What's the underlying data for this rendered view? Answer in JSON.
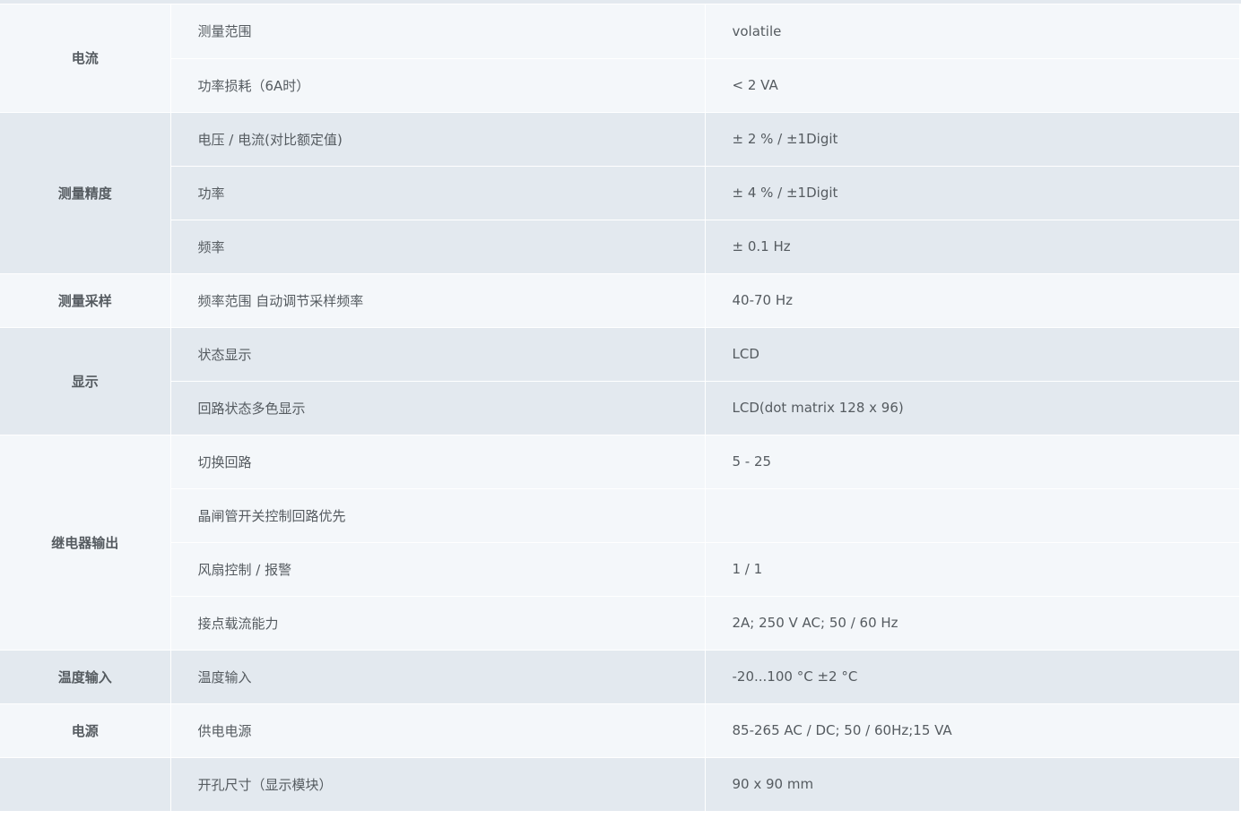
{
  "sections": [
    {
      "category": "电流",
      "rows": [
        {
          "item": "测量范围",
          "value": "volatile"
        },
        {
          "item": "功率损耗（6A时）",
          "value": "< 2 VA"
        }
      ]
    },
    {
      "category": "测量精度",
      "rows": [
        {
          "item": "电压 / 电流(对比额定值)",
          "value": "± 2 % / ±1Digit"
        },
        {
          "item": "功率",
          "value": "± 4 % / ±1Digit"
        },
        {
          "item": "频率",
          "value": "± 0.1 Hz"
        }
      ]
    },
    {
      "category": "测量采样",
      "rows": [
        {
          "item": "频率范围 自动调节采样频率",
          "value": "40-70 Hz"
        }
      ]
    },
    {
      "category": "显示",
      "rows": [
        {
          "item": "状态显示",
          "value": "LCD"
        },
        {
          "item": "回路状态多色显示",
          "value": "LCD(dot matrix 128 x 96)"
        }
      ]
    },
    {
      "category": "继电器输出",
      "rows": [
        {
          "item": "切换回路",
          "value": "5 - 25"
        },
        {
          "item": "晶闸管开关控制回路优先",
          "value": ""
        },
        {
          "item": "风扇控制 / 报警",
          "value": "1 / 1"
        },
        {
          "item": "接点载流能力",
          "value": "2A; 250 V AC; 50 / 60 Hz"
        }
      ]
    },
    {
      "category": "温度输入",
      "rows": [
        {
          "item": "温度输入",
          "value": "-20...100 °C ±2 °C"
        }
      ]
    },
    {
      "category": "电源",
      "rows": [
        {
          "item": "供电电源",
          "value": "85-265 AC / DC; 50 / 60Hz;15 VA"
        }
      ]
    },
    {
      "category": "",
      "rows": [
        {
          "item": "开孔尺寸（显示模块）",
          "value": "90 x 90 mm"
        }
      ]
    }
  ]
}
